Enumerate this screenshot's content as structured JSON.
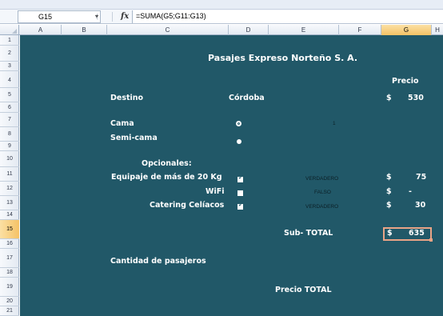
{
  "formula_bar": {
    "name_box": "G15",
    "formula": "=SUMA(G5;G11:G13)",
    "fx_label": "fx"
  },
  "columns": [
    "A",
    "B",
    "C",
    "D",
    "E",
    "F",
    "G",
    "H"
  ],
  "rows": [
    "1",
    "2",
    "3",
    "4",
    "5",
    "6",
    "7",
    "8",
    "9",
    "10",
    "11",
    "12",
    "13",
    "14",
    "15",
    "16",
    "17",
    "18",
    "19",
    "20",
    "21"
  ],
  "selected_cell": {
    "column": "G",
    "row": "15"
  },
  "sheet": {
    "title": "Pasajes Expreso Norteño S. A.",
    "precio_header": "Precio",
    "destino_label": "Destino",
    "destino_value": "Córdoba",
    "destino_currency": "$",
    "destino_price": "530",
    "cama_label": "Cama",
    "semicama_label": "Semi-cama",
    "seat_index": "1",
    "opcionales_label": "Opcionales:",
    "options": [
      {
        "label": "Equipaje de más de 20 Kg",
        "checked": true,
        "flag": "VERDADERO",
        "currency": "$",
        "price": "75"
      },
      {
        "label": "WiFi",
        "checked": false,
        "flag": "FALSO",
        "currency": "$",
        "price": "-"
      },
      {
        "label": "Catering Celíacos",
        "checked": true,
        "flag": "VERDADERO",
        "currency": "$",
        "price": "30"
      }
    ],
    "subtotal_label": "Sub- TOTAL",
    "subtotal_currency": "$",
    "subtotal_value": "635",
    "cantidad_label": "Cantidad de pasajeros",
    "precio_total_label": "Precio TOTAL"
  },
  "colors": {
    "sheet_bg": "#215868",
    "selection_border": "#e9a486",
    "selected_header": "#f5c266"
  }
}
